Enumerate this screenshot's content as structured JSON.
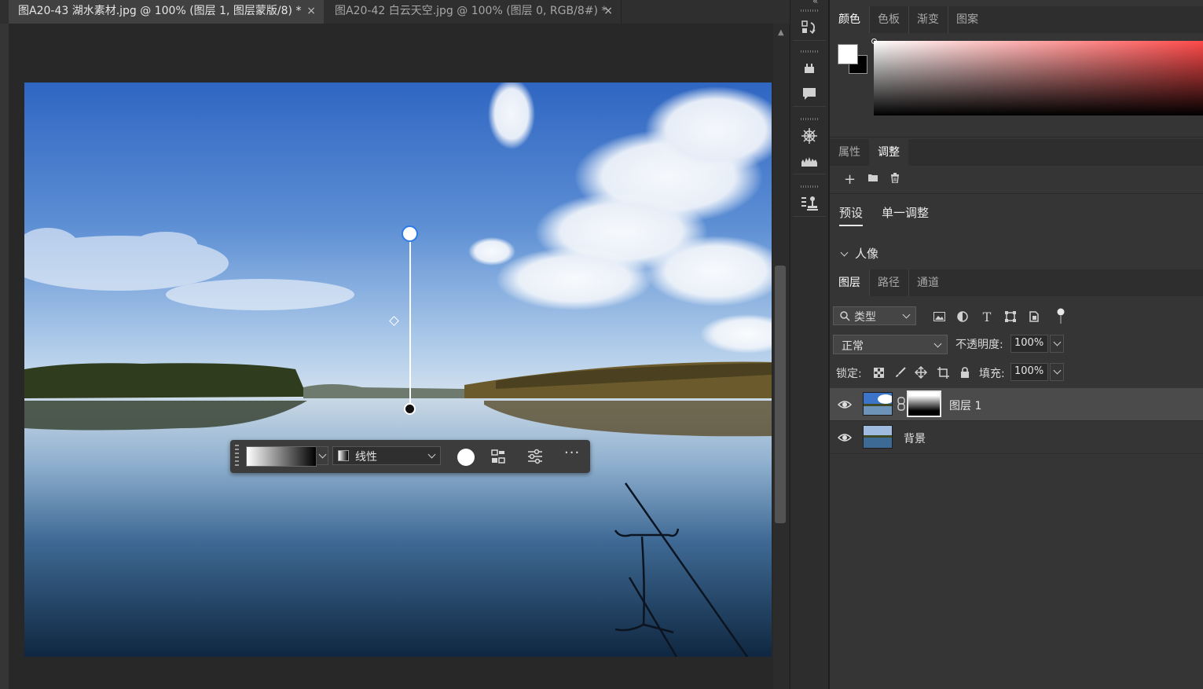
{
  "document_tabs": [
    {
      "title": "图A20-43 湖水素材.jpg @ 100% (图层 1, 图层蒙版/8) *",
      "active": true
    },
    {
      "title": "图A20-42 白云天空.jpg @ 100% (图层 0, RGB/8#) *",
      "active": false
    }
  ],
  "tab_close_glyph": "×",
  "gradient_toolbar": {
    "gradient_type": "线性",
    "icons": [
      "gradient-preview",
      "gradient-type-dropdown",
      "fill-circle-icon",
      "align-icon",
      "sliders-icon",
      "more-icon"
    ],
    "more_label": "···"
  },
  "tool_column": {
    "collapse_glyph": "«",
    "icons": [
      "history-icon",
      "plugin-icon",
      "comment-icon",
      "compass-icon",
      "histogram-icon",
      "stamp-icon"
    ]
  },
  "color_panel": {
    "tabs": [
      "颜色",
      "色板",
      "渐变",
      "图案"
    ],
    "active_tab": "颜色",
    "foreground": "#ffffff",
    "background": "#000000",
    "hue": "#ff4a4a"
  },
  "adjustments_panel": {
    "tabs": [
      "属性",
      "调整"
    ],
    "active_tab": "调整",
    "toolbar": [
      "+",
      "folder-icon",
      "trash-icon"
    ],
    "subtabs": [
      "预设",
      "单一调整"
    ],
    "active_subtab": "预设",
    "group_label": "人像"
  },
  "layers_panel": {
    "tabs": [
      "图层",
      "路径",
      "通道"
    ],
    "active_tab": "图层",
    "filter_label": "类型",
    "blend_mode": "正常",
    "opacity_label": "不透明度:",
    "opacity_value": "100%",
    "lock_label": "锁定:",
    "fill_label": "填充:",
    "fill_value": "100%",
    "layers": [
      {
        "name": "图层 1",
        "has_mask": true,
        "selected": true,
        "visible": true
      },
      {
        "name": "背景",
        "has_mask": false,
        "selected": false,
        "visible": true
      }
    ]
  }
}
